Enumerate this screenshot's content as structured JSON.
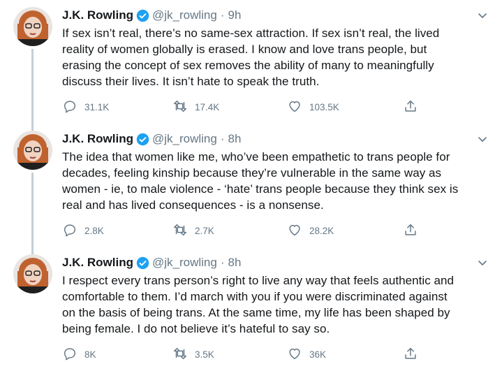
{
  "tweets": [
    {
      "author": {
        "name": "J.K. Rowling",
        "handle": "@jk_rowling",
        "time": "9h"
      },
      "text": "If sex isn’t real, there’s no same-sex attraction. If sex isn’t real, the lived\nreality of women globally is erased. I know and love trans people, but\nerasing the concept of sex removes the ability of many to meaningfully\ndiscuss their lives. It isn’t hate to speak the truth.",
      "stats": {
        "replies": "31.1K",
        "retweets": "17.4K",
        "likes": "103.5K"
      }
    },
    {
      "author": {
        "name": "J.K. Rowling",
        "handle": "@jk_rowling",
        "time": "8h"
      },
      "text": "The idea that women like me, who’ve been empathetic to trans people for\ndecades, feeling kinship because they’re vulnerable in the same way as\nwomen - ie, to male violence - ‘hate’ trans people because they think sex is\nreal and has lived consequences - is a nonsense.",
      "stats": {
        "replies": "2.8K",
        "retweets": "2.7K",
        "likes": "28.2K"
      }
    },
    {
      "author": {
        "name": "J.K. Rowling",
        "handle": "@jk_rowling",
        "time": "8h"
      },
      "text": "I respect every trans person’s right to live any way that feels authentic and\ncomfortable to them. I’d march with you if you were discriminated against\non the basis of being trans. At the same time, my life has been shaped by\nbeing female. I do not believe it’s hateful to say so.",
      "stats": {
        "replies": "8K",
        "retweets": "3.5K",
        "likes": "36K"
      }
    }
  ],
  "separator": "·",
  "icons": {
    "verified": "verified-badge-icon",
    "caret": "chevron-down-icon",
    "reply": "reply-icon",
    "retweet": "retweet-icon",
    "like": "heart-icon",
    "share": "share-icon"
  },
  "colors": {
    "accent": "#1da1f2",
    "secondary_text": "#657786",
    "primary_text": "#14171a",
    "thread_line": "#c4cfd6"
  }
}
